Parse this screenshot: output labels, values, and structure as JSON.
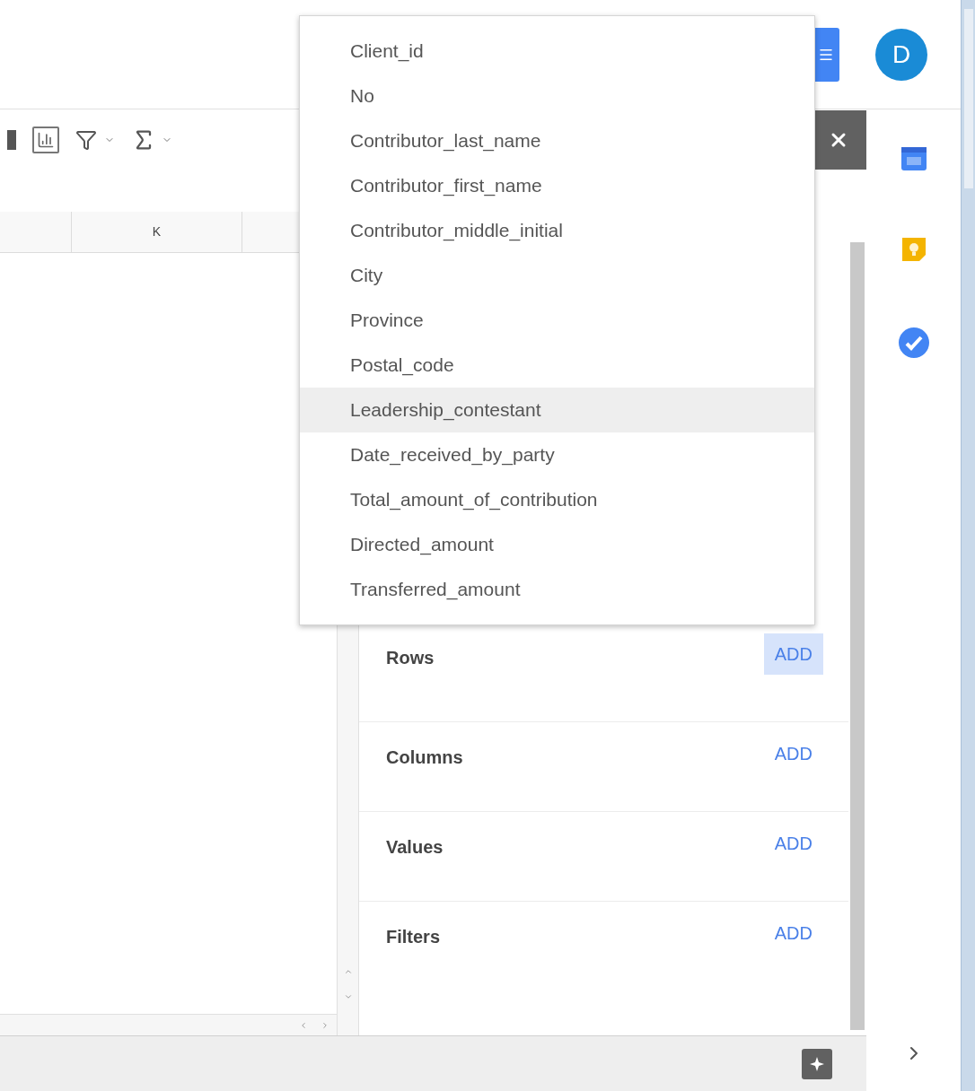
{
  "header": {
    "avatar": "D"
  },
  "sheet": {
    "column_header": "K"
  },
  "pivot_editor": {
    "sections": [
      {
        "label": "Rows",
        "action": "ADD",
        "focused": true
      },
      {
        "label": "Columns",
        "action": "ADD",
        "focused": false
      },
      {
        "label": "Values",
        "action": "ADD",
        "focused": false
      },
      {
        "label": "Filters",
        "action": "ADD",
        "focused": false
      }
    ]
  },
  "field_menu": {
    "items": [
      {
        "label": "Client_id",
        "selected": false
      },
      {
        "label": "No",
        "selected": false
      },
      {
        "label": "Contributor_last_name",
        "selected": false
      },
      {
        "label": "Contributor_first_name",
        "selected": false
      },
      {
        "label": "Contributor_middle_initial",
        "selected": false
      },
      {
        "label": "City",
        "selected": false
      },
      {
        "label": "Province",
        "selected": false
      },
      {
        "label": "Postal_code",
        "selected": false
      },
      {
        "label": "Leadership_contestant",
        "selected": true
      },
      {
        "label": "Date_received_by_party",
        "selected": false
      },
      {
        "label": "Total_amount_of_contribution",
        "selected": false
      },
      {
        "label": "Directed_amount",
        "selected": false
      },
      {
        "label": "Transferred_amount",
        "selected": false
      }
    ]
  }
}
